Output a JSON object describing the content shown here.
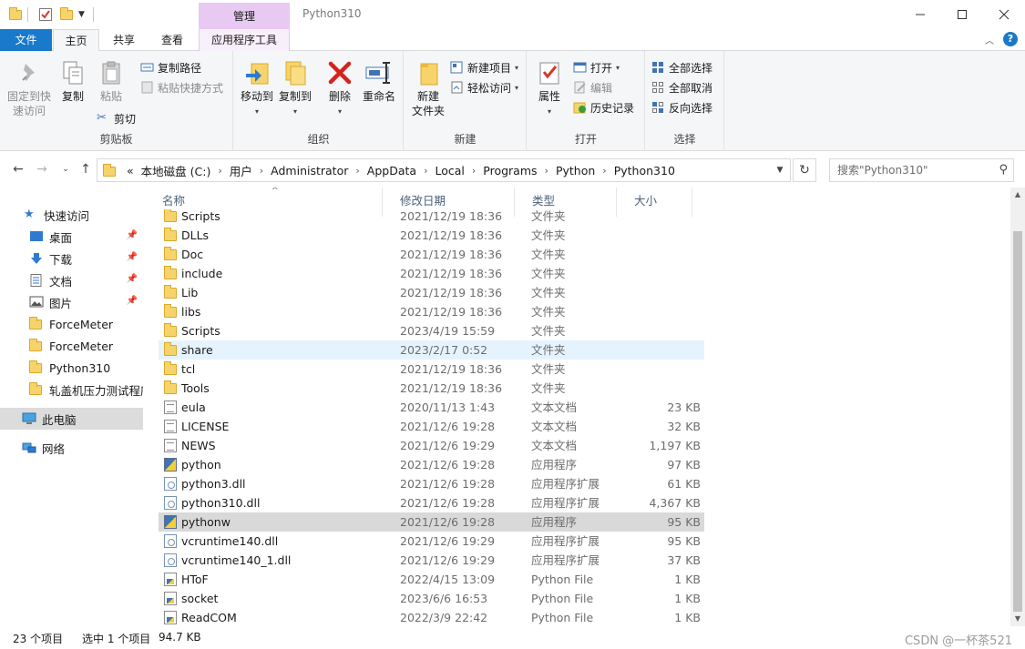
{
  "window": {
    "title": "Python310",
    "context_tab": "管理"
  },
  "tabs": {
    "file": "文件",
    "home": "主页",
    "share": "共享",
    "view": "查看",
    "app_tools": "应用程序工具"
  },
  "ribbon": {
    "clipboard": {
      "label": "剪贴板",
      "pin": "固定到快速访问",
      "pin_l1": "固定到快",
      "pin_l2": "速访问",
      "copy": "复制",
      "paste": "粘贴",
      "copy_path": "复制路径",
      "paste_shortcut": "粘贴快捷方式",
      "cut": "剪切"
    },
    "organize": {
      "label": "组织",
      "move_to": "移动到",
      "copy_to": "复制到",
      "delete": "删除",
      "rename": "重命名"
    },
    "new": {
      "label": "新建",
      "new_folder_l1": "新建",
      "new_folder_l2": "文件夹",
      "new_item": "新建项目",
      "easy_access": "轻松访问"
    },
    "open": {
      "label": "打开",
      "properties": "属性",
      "open": "打开",
      "edit": "编辑",
      "history": "历史记录"
    },
    "select": {
      "label": "选择",
      "select_all": "全部选择",
      "select_none": "全部取消",
      "invert": "反向选择"
    }
  },
  "address": {
    "overflow": "«",
    "crumbs": [
      "本地磁盘 (C:)",
      "用户",
      "Administrator",
      "AppData",
      "Local",
      "Programs",
      "Python",
      "Python310"
    ],
    "search_placeholder": "搜索\"Python310\""
  },
  "nav": {
    "quick_access": "快速访问",
    "desktop": "桌面",
    "downloads": "下载",
    "documents": "文档",
    "pictures": "图片",
    "force1": "ForceMeter",
    "force2": "ForceMeter",
    "python310": "Python310",
    "chinese_folder": "轧盖机压力测试程序",
    "this_pc": "此电脑",
    "network": "网络"
  },
  "columns": {
    "name": "名称",
    "date": "修改日期",
    "type": "类型",
    "size": "大小"
  },
  "files": [
    {
      "name": "Scripts",
      "date": "2021/12/19 18:36",
      "type": "文件夹",
      "size": ""
    },
    {
      "name": "DLLs",
      "date": "2021/12/19 18:36",
      "type": "文件夹",
      "size": ""
    },
    {
      "name": "Doc",
      "date": "2021/12/19 18:36",
      "type": "文件夹",
      "size": ""
    },
    {
      "name": "include",
      "date": "2021/12/19 18:36",
      "type": "文件夹",
      "size": ""
    },
    {
      "name": "Lib",
      "date": "2021/12/19 18:36",
      "type": "文件夹",
      "size": ""
    },
    {
      "name": "libs",
      "date": "2021/12/19 18:36",
      "type": "文件夹",
      "size": ""
    },
    {
      "name": "Scripts",
      "date": "2023/4/19 15:59",
      "type": "文件夹",
      "size": ""
    },
    {
      "name": "share",
      "date": "2023/2/17 0:52",
      "type": "文件夹",
      "size": ""
    },
    {
      "name": "tcl",
      "date": "2021/12/19 18:36",
      "type": "文件夹",
      "size": ""
    },
    {
      "name": "Tools",
      "date": "2021/12/19 18:36",
      "type": "文件夹",
      "size": ""
    },
    {
      "name": "eula",
      "date": "2020/11/13 1:43",
      "type": "文本文档",
      "size": "23 KB"
    },
    {
      "name": "LICENSE",
      "date": "2021/12/6 19:28",
      "type": "文本文档",
      "size": "32 KB"
    },
    {
      "name": "NEWS",
      "date": "2021/12/6 19:29",
      "type": "文本文档",
      "size": "1,197 KB"
    },
    {
      "name": "python",
      "date": "2021/12/6 19:28",
      "type": "应用程序",
      "size": "97 KB"
    },
    {
      "name": "python3.dll",
      "date": "2021/12/6 19:28",
      "type": "应用程序扩展",
      "size": "61 KB"
    },
    {
      "name": "python310.dll",
      "date": "2021/12/6 19:28",
      "type": "应用程序扩展",
      "size": "4,367 KB"
    },
    {
      "name": "pythonw",
      "date": "2021/12/6 19:28",
      "type": "应用程序",
      "size": "95 KB"
    },
    {
      "name": "vcruntime140.dll",
      "date": "2021/12/6 19:29",
      "type": "应用程序扩展",
      "size": "95 KB"
    },
    {
      "name": "vcruntime140_1.dll",
      "date": "2021/12/6 19:29",
      "type": "应用程序扩展",
      "size": "37 KB"
    },
    {
      "name": "HToF",
      "date": "2022/4/15 13:09",
      "type": "Python File",
      "size": "1 KB"
    },
    {
      "name": "socket",
      "date": "2023/6/6 16:53",
      "type": "Python File",
      "size": "1 KB"
    },
    {
      "name": "ReadCOM",
      "date": "2022/3/9 22:42",
      "type": "Python File",
      "size": "1 KB"
    }
  ],
  "status": {
    "count": "23 个项目",
    "selected": "选中 1 个项目",
    "size": "94.7 KB",
    "watermark": "CSDN @一杯茶521"
  },
  "colors": {
    "file_tab": "#1979ca",
    "context_tab": "#e8c9f2",
    "hover_row": "#e5f3ff",
    "selected_row": "#d9d9d9"
  }
}
